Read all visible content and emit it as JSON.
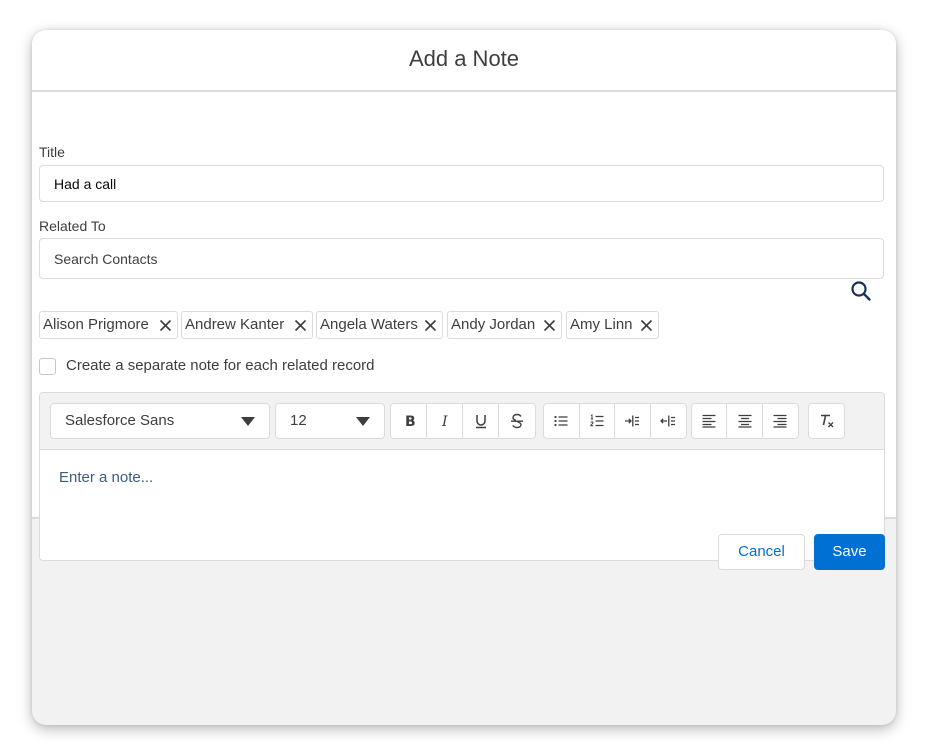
{
  "modal": {
    "title": "Add a Note"
  },
  "form": {
    "title_label": "Title",
    "title_value": "Had a call",
    "related_label": "Related To",
    "search_placeholder": "Search Contacts",
    "related_pills": [
      "Alison Prigmore",
      "Andrew Kanter",
      "Angela Waters",
      "Andy Jordan",
      "Amy Linn"
    ],
    "separate_note_label": "Create a separate note for each related record",
    "separate_note_checked": false
  },
  "editor": {
    "font_family": "Salesforce Sans",
    "font_size": "12",
    "placeholder": "Enter a note...",
    "toolbar_icons": [
      "bold-icon",
      "italic-icon",
      "underline-icon",
      "strikethrough-icon",
      "bulleted-list-icon",
      "numbered-list-icon",
      "indent-icon",
      "outdent-icon",
      "align-left-icon",
      "align-center-icon",
      "align-right-icon",
      "clear-formatting-icon"
    ]
  },
  "footer": {
    "cancel_label": "Cancel",
    "save_label": "Save"
  },
  "colors": {
    "brand": "#0070d2",
    "border": "#dddbda",
    "footer_bg": "#f3f2f2"
  }
}
